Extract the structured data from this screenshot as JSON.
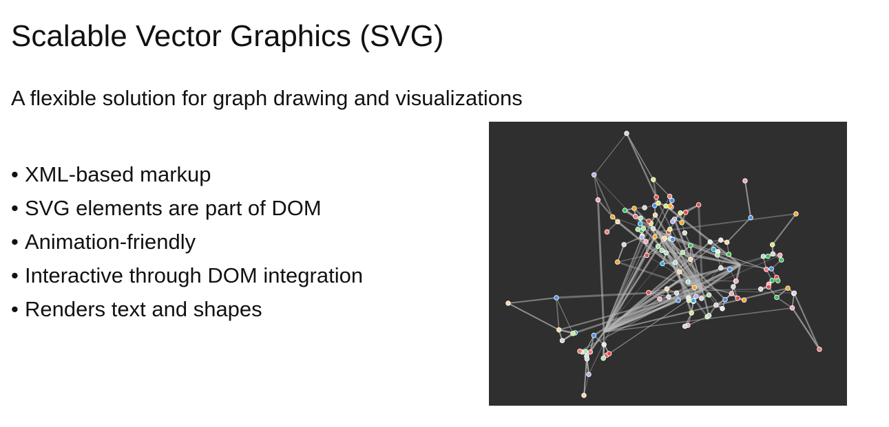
{
  "slide": {
    "title": "Scalable Vector Graphics (SVG)",
    "subtitle": "A flexible solution for graph drawing and visualizations",
    "bullet_glyph": "•",
    "bullets": [
      "XML-based markup",
      "SVG elements are part of DOM",
      "Animation-friendly",
      "Interactive through DOM integration",
      "Renders text and shapes"
    ]
  },
  "graph": {
    "background": "#2f2f2f",
    "edge_color": "#b8b8b8",
    "node_stroke": "#ffffff",
    "palette": [
      "#e8e8e8",
      "#d6d6d6",
      "#f4a6b8",
      "#f07a7a",
      "#e84a4a",
      "#a8e6a0",
      "#3cc05a",
      "#2bb0d8",
      "#4a90e2",
      "#b6b0e8",
      "#f5a623",
      "#f7d9a0",
      "#d9e87a",
      "#b0e0c8"
    ]
  }
}
